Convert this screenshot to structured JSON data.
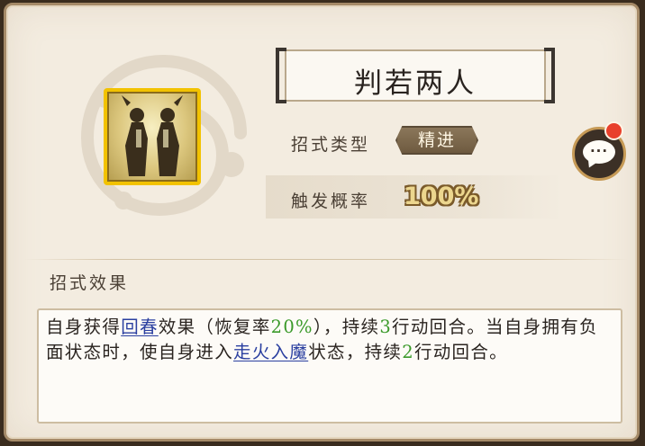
{
  "skill": {
    "name": "判若两人",
    "type_label": "招式类型",
    "type_value": "精进",
    "rate_label": "触发概率",
    "rate_value": "100%"
  },
  "effect": {
    "section_title": "招式效果",
    "segments": [
      {
        "text": "自身获得",
        "style": "plain"
      },
      {
        "text": "回春",
        "style": "keyword"
      },
      {
        "text": "效果（恢复率",
        "style": "plain"
      },
      {
        "text": "20%",
        "style": "number"
      },
      {
        "text": "），持续",
        "style": "plain"
      },
      {
        "text": "3",
        "style": "number"
      },
      {
        "text": "行动回合。当自身拥有负面状态时，使自身进入",
        "style": "plain"
      },
      {
        "text": "走火入魔",
        "style": "keyword"
      },
      {
        "text": "状态，持续",
        "style": "plain"
      },
      {
        "text": "2",
        "style": "number"
      },
      {
        "text": "行动回合。",
        "style": "plain"
      }
    ]
  },
  "chat": {
    "icon": "chat-bubble-icon",
    "dots": "···",
    "has_notification": true
  },
  "colors": {
    "keyword": "#2a3fa0",
    "number": "#3b9a2a",
    "badge": "#7a6548",
    "icon_border": "#f2c200",
    "notification": "#e8402c"
  }
}
